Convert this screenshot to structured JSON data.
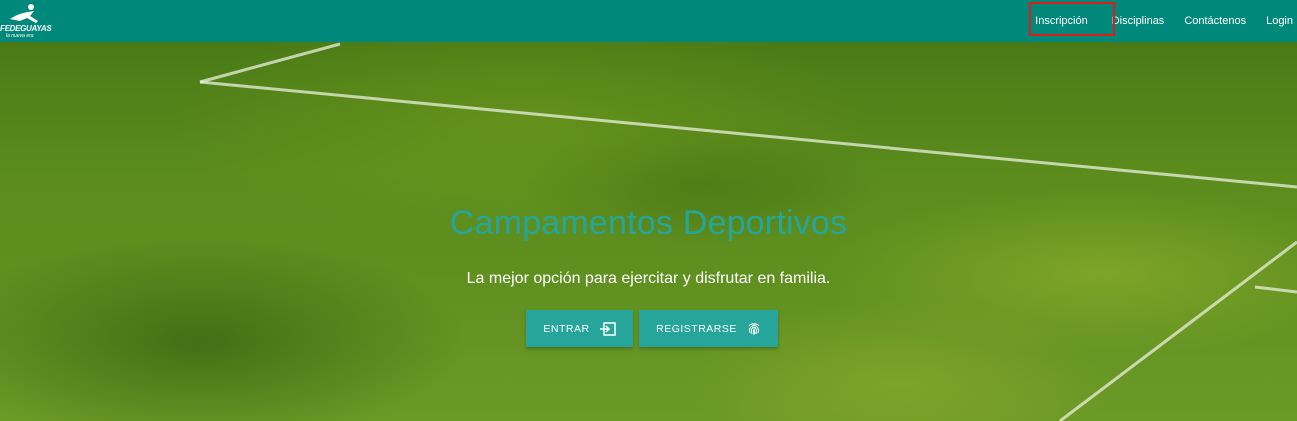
{
  "brand": {
    "name": "FEDEGUAYAS",
    "tagline": "la nueva era"
  },
  "nav": {
    "items": [
      {
        "label": "Inscripción"
      },
      {
        "label": "Disciplinas"
      },
      {
        "label": "Contáctenos"
      },
      {
        "label": "Login"
      }
    ]
  },
  "hero": {
    "title": "Campamentos Deportivos",
    "subtitle": "La mejor opción para ejercitar y disfrutar en familia.",
    "buttons": {
      "entrar": {
        "label": "ENTRAR",
        "icon": "login-icon"
      },
      "registrarse": {
        "label": "REGISTRARSE",
        "icon": "fingerprint-icon"
      }
    }
  },
  "colors": {
    "navbar": "#00897b",
    "accent": "#26a69a",
    "highlight": "#e21b1b"
  }
}
